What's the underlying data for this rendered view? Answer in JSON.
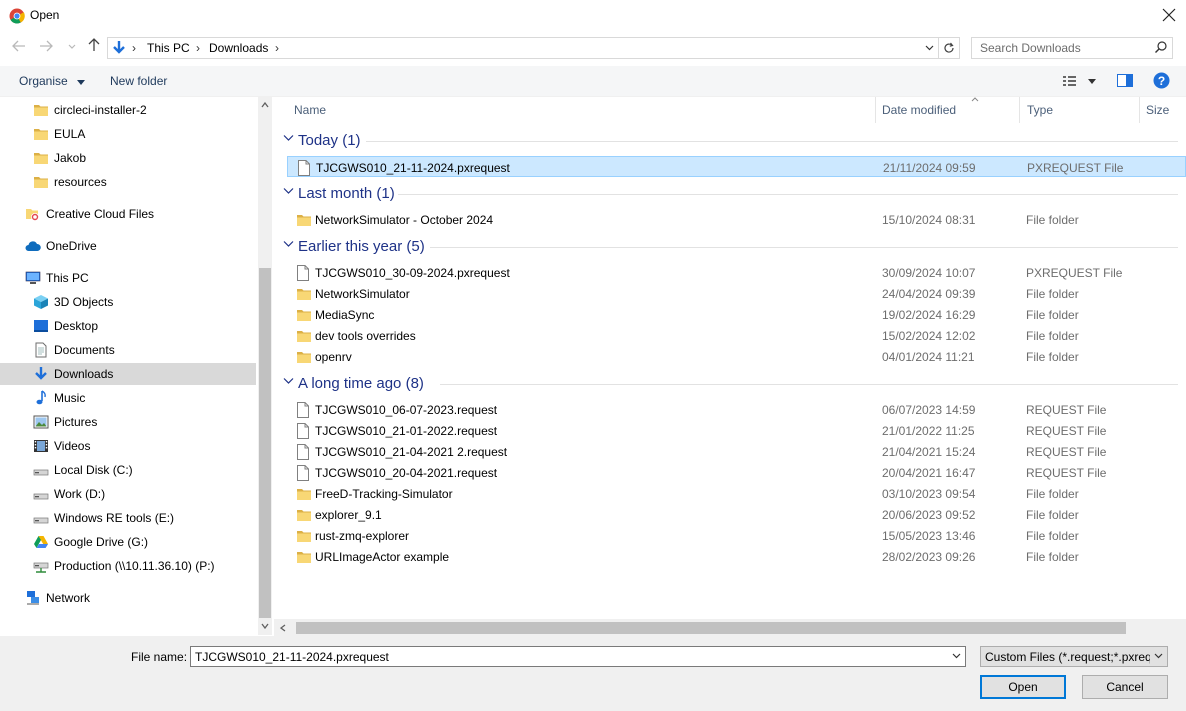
{
  "window": {
    "title": "Open",
    "icon": "chrome-icon"
  },
  "address": {
    "crumbs": [
      "This PC",
      "Downloads"
    ],
    "search_placeholder": "Search Downloads"
  },
  "toolbar": {
    "organise": "Organise",
    "new_folder": "New folder"
  },
  "sidebar": {
    "items": [
      {
        "label": "circleci-installer-2",
        "icon": "folder-icon"
      },
      {
        "label": "EULA",
        "icon": "folder-icon"
      },
      {
        "label": "Jakob",
        "icon": "folder-icon"
      },
      {
        "label": "resources",
        "icon": "folder-icon"
      },
      {
        "label": "Creative Cloud Files",
        "icon": "creative-cloud-icon"
      },
      {
        "label": "OneDrive",
        "icon": "cloud-icon"
      },
      {
        "label": "This PC",
        "icon": "computer-icon"
      },
      {
        "label": "3D Objects",
        "icon": "cube-icon"
      },
      {
        "label": "Desktop",
        "icon": "desktop-icon"
      },
      {
        "label": "Documents",
        "icon": "document-icon"
      },
      {
        "label": "Downloads",
        "icon": "download-icon"
      },
      {
        "label": "Music",
        "icon": "music-icon"
      },
      {
        "label": "Pictures",
        "icon": "picture-icon"
      },
      {
        "label": "Videos",
        "icon": "video-icon"
      },
      {
        "label": "Local Disk (C:)",
        "icon": "drive-icon"
      },
      {
        "label": "Work (D:)",
        "icon": "drive-icon"
      },
      {
        "label": "Windows RE tools (E:)",
        "icon": "drive-icon"
      },
      {
        "label": "Google Drive (G:)",
        "icon": "google-drive-icon"
      },
      {
        "label": "Production (\\\\10.11.36.10) (P:)",
        "icon": "network-drive-icon"
      },
      {
        "label": "Network",
        "icon": "network-icon"
      }
    ]
  },
  "columns": {
    "name": "Name",
    "date": "Date modified",
    "type": "Type",
    "size": "Size"
  },
  "groups": [
    {
      "label": "Today (1)",
      "files": [
        {
          "name": "TJCGWS010_21-11-2024.pxrequest",
          "date": "21/11/2024 09:59",
          "type": "PXREQUEST File",
          "kind": "file"
        }
      ]
    },
    {
      "label": "Last month (1)",
      "files": [
        {
          "name": "NetworkSimulator - October 2024",
          "date": "15/10/2024 08:31",
          "type": "File folder",
          "kind": "folder"
        }
      ]
    },
    {
      "label": "Earlier this year (5)",
      "files": [
        {
          "name": "TJCGWS010_30-09-2024.pxrequest",
          "date": "30/09/2024 10:07",
          "type": "PXREQUEST File",
          "kind": "file"
        },
        {
          "name": "NetworkSimulator",
          "date": "24/04/2024 09:39",
          "type": "File folder",
          "kind": "folder"
        },
        {
          "name": "MediaSync",
          "date": "19/02/2024 16:29",
          "type": "File folder",
          "kind": "folder"
        },
        {
          "name": "dev tools overrides",
          "date": "15/02/2024 12:02",
          "type": "File folder",
          "kind": "folder"
        },
        {
          "name": "openrv",
          "date": "04/01/2024 11:21",
          "type": "File folder",
          "kind": "folder"
        }
      ]
    },
    {
      "label": "A long time ago (8)",
      "files": [
        {
          "name": "TJCGWS010_06-07-2023.request",
          "date": "06/07/2023 14:59",
          "type": "REQUEST File",
          "kind": "file"
        },
        {
          "name": "TJCGWS010_21-01-2022.request",
          "date": "21/01/2022 11:25",
          "type": "REQUEST File",
          "kind": "file"
        },
        {
          "name": "TJCGWS010_21-04-2021 2.request",
          "date": "21/04/2021 15:24",
          "type": "REQUEST File",
          "kind": "file"
        },
        {
          "name": "TJCGWS010_20-04-2021.request",
          "date": "20/04/2021 16:47",
          "type": "REQUEST File",
          "kind": "file"
        },
        {
          "name": "FreeD-Tracking-Simulator",
          "date": "03/10/2023 09:54",
          "type": "File folder",
          "kind": "folder"
        },
        {
          "name": "explorer_9.1",
          "date": "20/06/2023 09:52",
          "type": "File folder",
          "kind": "folder"
        },
        {
          "name": "rust-zmq-explorer",
          "date": "15/05/2023 13:46",
          "type": "File folder",
          "kind": "folder"
        },
        {
          "name": "URLImageActor example",
          "date": "28/02/2023 09:26",
          "type": "File folder",
          "kind": "folder"
        }
      ]
    }
  ],
  "footer": {
    "file_name_label": "File name:",
    "file_name_value": "TJCGWS010_21-11-2024.pxrequest",
    "filter": "Custom Files (*.request;*.pxrequest)",
    "open": "Open",
    "cancel": "Cancel"
  },
  "colors": {
    "accent": "#0078d7",
    "group_text": "#1e3287",
    "selection": "#cce8ff"
  }
}
